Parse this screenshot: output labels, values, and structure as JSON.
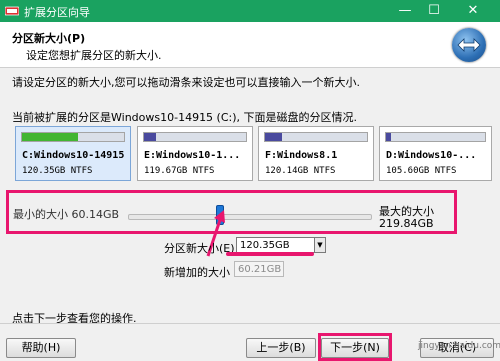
{
  "window": {
    "title": "扩展分区向导",
    "controls": {
      "minimize": "—",
      "maximize": "☐",
      "close": "✕"
    }
  },
  "header": {
    "title": "分区新大小(P)",
    "subtitle": "设定您想扩展分区的新大小."
  },
  "instruction": "请设定分区的新大小,您可以拖动滑条来设定也可以直接输入一个新大小.",
  "current_info": "当前被扩展的分区是Windows10-14915 (C:), 下面是磁盘的分区情况.",
  "partitions": [
    {
      "name": "C:Windows10-14915",
      "size": "120.35GB NTFS",
      "used_fraction": 0.55,
      "color": "#41b532",
      "selected": true
    },
    {
      "name": "E:Windows10-1...",
      "size": "119.67GB NTFS",
      "used_fraction": 0.12,
      "color": "#4a4a9e",
      "selected": false
    },
    {
      "name": "F:Windows8.1",
      "size": "120.14GB NTFS",
      "used_fraction": 0.17,
      "color": "#4a4a9e",
      "selected": false
    },
    {
      "name": "D:Windows10-...",
      "size": "105.60GB NTFS",
      "used_fraction": 0.05,
      "color": "#4a4a9e",
      "selected": false
    }
  ],
  "slider": {
    "min_label": "最小的大小",
    "min_value": "60.14GB",
    "max_label": "最大的大小",
    "max_value": "219.84GB",
    "position_fraction": 0.38
  },
  "size_field": {
    "label": "分区新大小(E)",
    "value": "120.35GB"
  },
  "added_field": {
    "label": "新增加的大小",
    "value": "60.21GB"
  },
  "footer_text": "点击下一步查看您的操作.",
  "buttons": {
    "help": "帮助(H)",
    "back": "上一步(B)",
    "next": "下一步(N)",
    "cancel": "取消(C)"
  },
  "watermark": "jingyan.baidu.com",
  "colors": {
    "titlebar": "#1aa260",
    "highlight": "#e8166e",
    "thumb": "#1e78d8"
  }
}
